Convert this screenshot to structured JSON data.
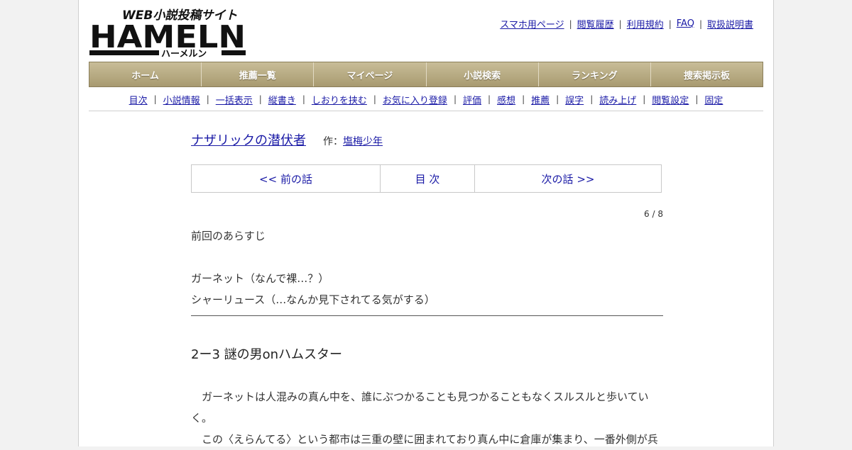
{
  "header": {
    "logo_tagline": "WEB小説投稿サイト",
    "logo_main": "HAMELN",
    "logo_kana": "ハーメルン"
  },
  "top_links": [
    "スマホ用ページ",
    "閲覧履歴",
    "利用規約",
    "FAQ",
    "取扱説明書"
  ],
  "global_nav": [
    "ホーム",
    "推薦一覧",
    "マイページ",
    "小説検索",
    "ランキング",
    "捜索掲示板"
  ],
  "sub_nav": [
    "目次",
    "小説情報",
    "一括表示",
    "縦書き",
    "しおりを挟む",
    "お気に入り登録",
    "評価",
    "感想",
    "推薦",
    "誤字",
    "読み上げ",
    "閲覧設定",
    "固定"
  ],
  "novel": {
    "title": "ナザリックの潜伏者",
    "author_prefix": "作：",
    "author": "塩梅少年"
  },
  "pager": {
    "prev": "<< 前の話",
    "toc": "目 次",
    "next": "次の話 >>"
  },
  "page_count": "6 / 8",
  "preface": {
    "heading": "前回のあらすじ",
    "line1": "ガーネット（なんで裸…？）",
    "line2": "シャーリュース（…なんか見下されてる気がする）"
  },
  "chapter_title": "2ー3 謎の男onハムスター",
  "body": {
    "line1": "　ガーネットは人混みの真ん中を、誰にぶつかることも見つかることもなくスルスルと歩いてい",
    "line2": "く。",
    "line3": "　この〈えらんてる〉という都市は三重の壁に囲まれており真ん中に倉庫が集まり、一番外側が兵"
  }
}
